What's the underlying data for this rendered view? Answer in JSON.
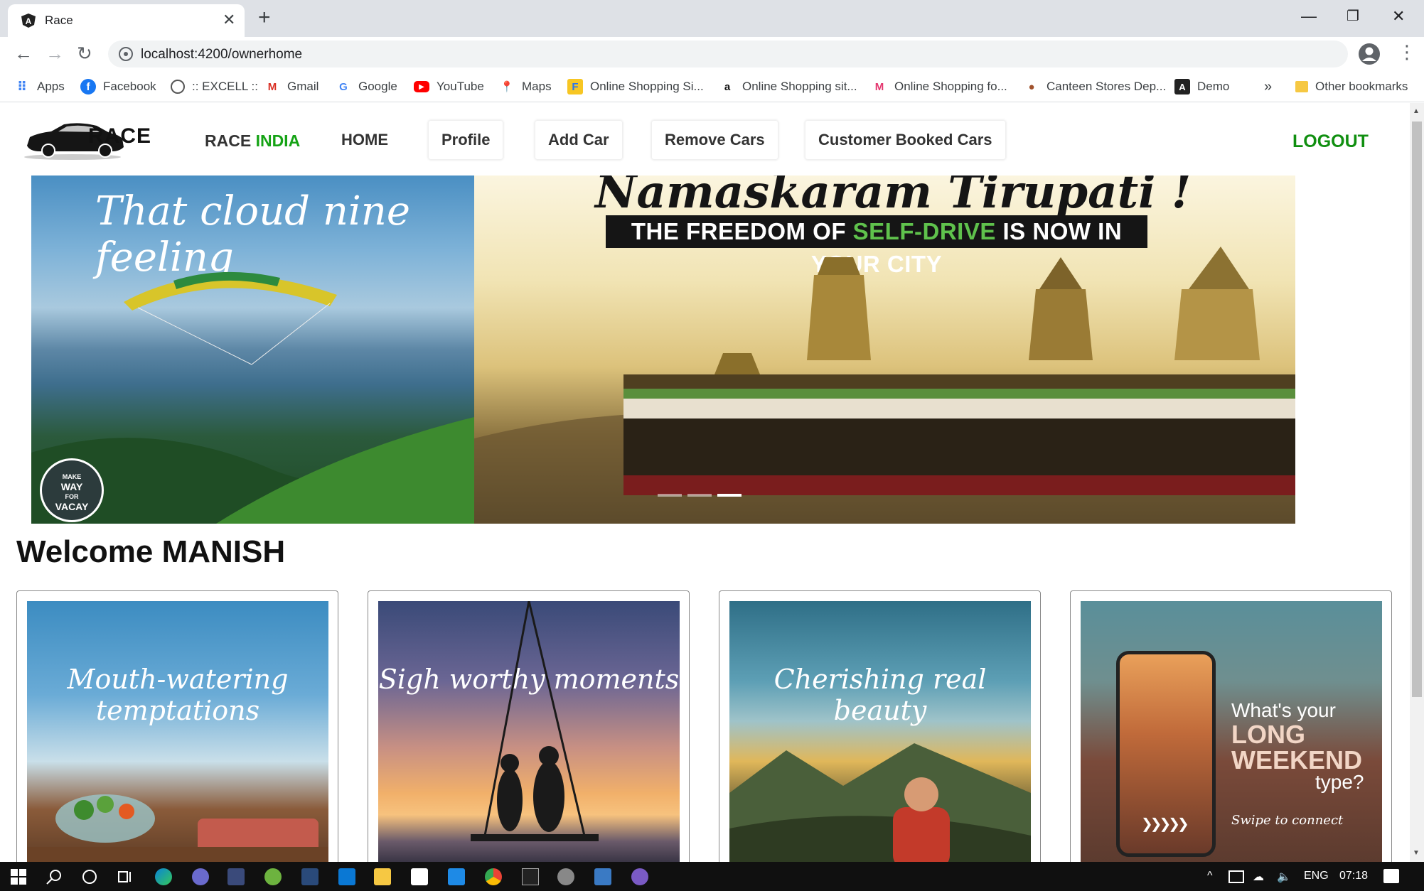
{
  "browser": {
    "tab_title": "Race",
    "url": "localhost:4200/ownerhome",
    "bookmarks": [
      {
        "label": "Apps",
        "icon": "apps-grid-icon"
      },
      {
        "label": "Facebook",
        "icon": "facebook-icon"
      },
      {
        "label": ":: EXCELL ::",
        "icon": "globe-icon"
      },
      {
        "label": "Gmail",
        "icon": "gmail-icon"
      },
      {
        "label": "Google",
        "icon": "google-icon"
      },
      {
        "label": "YouTube",
        "icon": "youtube-icon"
      },
      {
        "label": "Maps",
        "icon": "maps-pin-icon"
      },
      {
        "label": "Online Shopping Si...",
        "icon": "shopping-bag-icon"
      },
      {
        "label": "Online Shopping sit...",
        "icon": "amazon-icon"
      },
      {
        "label": "Online Shopping fo...",
        "icon": "myntra-icon"
      },
      {
        "label": "Canteen Stores Dep...",
        "icon": "canteen-icon"
      },
      {
        "label": "Demo",
        "icon": "angular-icon"
      }
    ],
    "more_bookmarks": "»",
    "other_bookmarks": "Other bookmarks"
  },
  "nav": {
    "logo_text": "RACE",
    "brand_main": "RACE",
    "brand_accent": "INDIA",
    "items": [
      {
        "label": "HOME"
      },
      {
        "label": "Profile"
      },
      {
        "label": "Add Car"
      },
      {
        "label": "Remove Cars"
      },
      {
        "label": "Customer Booked Cars"
      }
    ],
    "logout": "LOGOUT"
  },
  "banner": {
    "left_title": "That cloud nine feeling",
    "badge_lines": [
      "MAKE",
      "WAY",
      "FOR",
      "VACAY"
    ],
    "right_title": "Namaskaram Tirupati !",
    "tagline_pre": "THE FREEDOM OF ",
    "tagline_highlight": "SELF-DRIVE",
    "tagline_post": " IS NOW IN YOUR CITY"
  },
  "welcome": "Welcome MANISH",
  "cards": [
    {
      "caption": "Mouth-watering temptations"
    },
    {
      "caption": "Sigh worthy moments"
    },
    {
      "caption": "Cherishing real beauty"
    },
    {
      "caption_lines": [
        "What's your",
        "LONG",
        "WEEKEND",
        "type?"
      ],
      "sub": "Swipe to connect"
    }
  ],
  "taskbar": {
    "language": "ENG",
    "time": "07:18"
  },
  "colors": {
    "brand_accent": "#15a315",
    "logout": "#108f10",
    "highlight": "#5fc24c"
  }
}
